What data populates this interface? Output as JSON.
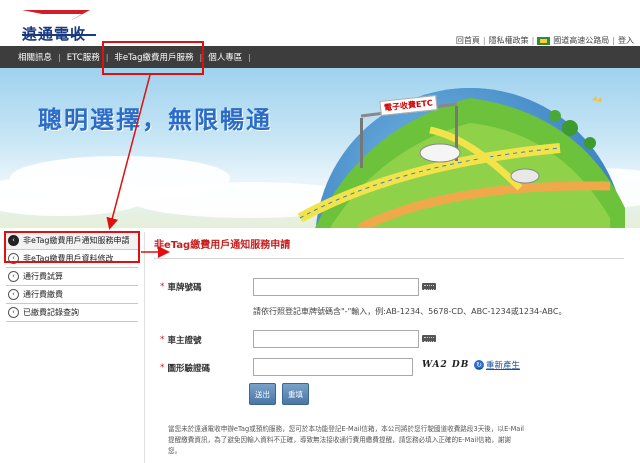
{
  "header": {
    "logo_text": "遠通電收",
    "links": [
      "回首頁",
      "隱私權政策",
      "國道高速公路局",
      "登入"
    ]
  },
  "nav": {
    "items": [
      "相關訊息",
      "ETC服務",
      "非eTag繳費用戶服務",
      "個人專區"
    ]
  },
  "banner": {
    "slogan": "聰明選擇，無限暢通",
    "sign": "電子收費ETC"
  },
  "sidebar": {
    "items": [
      {
        "label": "非eTag繳費用戶通知服務申請",
        "active": true
      },
      {
        "label": "非eTag繳費用戶資料修改",
        "active": false
      },
      {
        "label": "通行費試算",
        "active": false
      },
      {
        "label": "通行費繳費",
        "active": false
      },
      {
        "label": "已繳費記錄查詢",
        "active": false
      }
    ]
  },
  "main": {
    "title": "非eTag繳費用戶通知服務申請",
    "plate_label": "車牌號碼",
    "plate_hint": "請依行照登記車牌號碼含\"-\"輸入，例:AB-1234、5678-CD、ABC-1234或1234-ABC。",
    "id_label": "車主證號",
    "captcha_label": "圖形驗證碼",
    "captcha_code": "WA2 DB",
    "refresh_label": "重新產生",
    "submit_label": "送出",
    "reset_label": "重填",
    "note": "當您未於遠通電收申辦eTag或預約服務，您可於本功能登記E-Mail信箱，本公司將於您行駛國道收費路段3天後，以E-Mail提醒繳費資訊，為了避免因輸入資料不正確，導致無法接收通行費用繳費提醒，請您務必填入正確的E-Mail信箱，謝謝您。"
  },
  "colors": {
    "nav_bg": "#3d3d3d",
    "title_red": "#c81e1e",
    "slogan_blue": "#2a6cc8",
    "annotation_red": "#e01010"
  }
}
